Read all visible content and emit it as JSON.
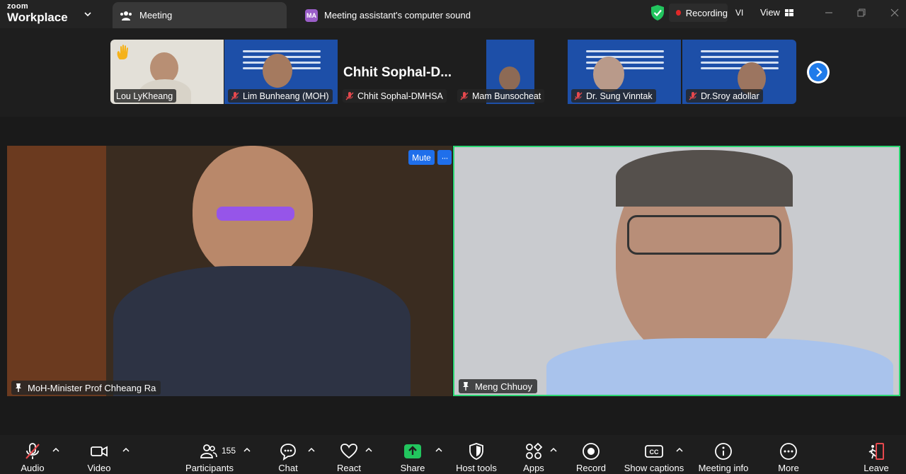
{
  "app": {
    "brand_top": "zoom",
    "brand_bottom": "Workplace"
  },
  "tabs": {
    "meeting_label": "Meeting",
    "assistant_badge": "MA",
    "assistant_label": "Meeting assistant's computer sound"
  },
  "header": {
    "recording_label": "Recording",
    "language_label": "VI",
    "view_label": "View"
  },
  "filmstrip": {
    "participants": [
      {
        "name": "Lou LyKheang",
        "muted": false,
        "hand_raised": true
      },
      {
        "name": "Lim Bunheang (MOH)",
        "muted": true
      },
      {
        "name": "Chhit Sophal-DMHSA",
        "muted": true,
        "display_text": "Chhit  Sophal-D..."
      },
      {
        "name": "Mam Bunsocheat",
        "muted": true
      },
      {
        "name": "Dr. Sung Vinntak",
        "muted": true
      },
      {
        "name": "Dr.Sroy adollar",
        "muted": true
      }
    ]
  },
  "main": {
    "left": {
      "name": "MoH-Minister Prof Chheang Ra",
      "mute_label": "Mute",
      "more_label": "···"
    },
    "right": {
      "name": "Meng Chhuoy"
    }
  },
  "toolbar": {
    "audio": "Audio",
    "video": "Video",
    "participants": "Participants",
    "participants_count": "155",
    "chat": "Chat",
    "react": "React",
    "share": "Share",
    "host_tools": "Host tools",
    "apps": "Apps",
    "record": "Record",
    "show_captions": "Show captions",
    "meeting_info": "Meeting info",
    "more": "More",
    "leave": "Leave"
  },
  "colors": {
    "accent_blue": "#1f6feb",
    "share_green": "#22c55e",
    "recording_red": "#e02828",
    "active_speaker_border": "#2bd672",
    "leave_red": "#e5484d"
  }
}
